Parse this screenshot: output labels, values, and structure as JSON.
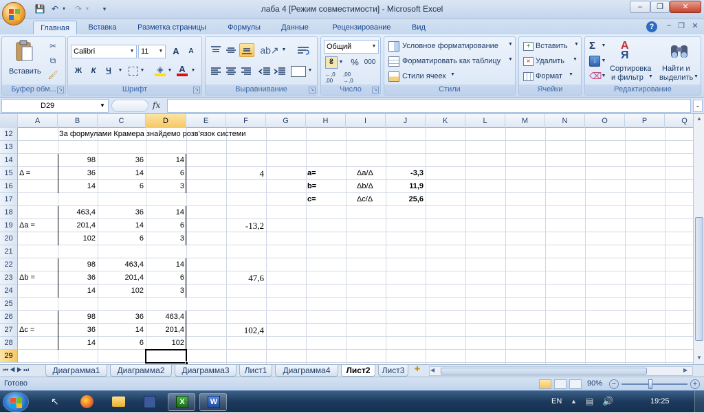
{
  "window": {
    "title": "лаба 4  [Режим совместимости] - Microsoft Excel",
    "qat_save": "💾",
    "qat_undo": "↶",
    "qat_redo": "↷",
    "minimize": "–",
    "restore": "❐",
    "close": "✕",
    "doc_minimize": "–",
    "doc_restore": "❐",
    "doc_close": "✕"
  },
  "ribbon": {
    "tabs": [
      "Главная",
      "Вставка",
      "Разметка страницы",
      "Формулы",
      "Данные",
      "Рецензирование",
      "Вид"
    ],
    "active_tab": "Главная",
    "help_icon": "?",
    "clipboard": {
      "label": "Буфер обм...",
      "paste": "Вставить"
    },
    "font": {
      "label": "Шрифт",
      "name": "Calibri",
      "size": "11",
      "grow": "A",
      "shrink": "A",
      "bold": "Ж",
      "italic": "К",
      "underline": "Ч",
      "color_letter": "A"
    },
    "alignment": {
      "label": "Выравнивание"
    },
    "number": {
      "label": "Число",
      "format": "Общий",
      "percent": "%",
      "thousands": "000",
      "inc_dec": "←,0 ,00",
      "dec_dec": ",00 →,0"
    },
    "styles": {
      "label": "Стили",
      "conditional": "Условное форматирование",
      "as_table": "Форматировать как таблицу",
      "cell_styles": "Стили ячеек"
    },
    "cells": {
      "label": "Ячейки",
      "insert": "Вставить",
      "delete": "Удалить",
      "format": "Формат"
    },
    "editing": {
      "label": "Редактирование",
      "sum": "Σ",
      "sort_l1": "Сортировка",
      "sort_l2": "и фильтр",
      "find_l1": "Найти и",
      "find_l2": "выделить"
    }
  },
  "formula_bar": {
    "name_box": "D29",
    "fx": "fx",
    "content": ""
  },
  "columns": [
    "A",
    "B",
    "C",
    "D",
    "E",
    "F",
    "G",
    "H",
    "I",
    "J",
    "K",
    "L",
    "M",
    "N",
    "O",
    "P",
    "Q"
  ],
  "selected_column": "D",
  "rows": [
    "12",
    "13",
    "14",
    "15",
    "16",
    "17",
    "18",
    "19",
    "20",
    "21",
    "22",
    "23",
    "24",
    "25",
    "26",
    "27",
    "28",
    "29"
  ],
  "selected_row": "29",
  "cells": {
    "r12_b": "За формулами Крамера знайдемо розв'язок системи",
    "r14": [
      "98",
      "36",
      "14"
    ],
    "r15_a": "Δ =",
    "r15": [
      "36",
      "14",
      "6"
    ],
    "r15_f": "4",
    "r16": [
      "14",
      "6",
      "3"
    ],
    "r18": [
      "463,4",
      "36",
      "14"
    ],
    "r19_a": "Δa =",
    "r19": [
      "201,4",
      "14",
      "6"
    ],
    "r19_f": "-13,2",
    "r20": [
      "102",
      "6",
      "3"
    ],
    "r22": [
      "98",
      "463,4",
      "14"
    ],
    "r23_a": "Δb =",
    "r23": [
      "36",
      "201,4",
      "6"
    ],
    "r23_f": "47,6",
    "r24": [
      "14",
      "102",
      "3"
    ],
    "r26": [
      "98",
      "36",
      "463,4"
    ],
    "r27_a": "Δc =",
    "r27": [
      "36",
      "14",
      "201,4"
    ],
    "r27_f": "102,4",
    "r28": [
      "14",
      "6",
      "102"
    ],
    "results": [
      {
        "name": "a=",
        "formula": "Δa/Δ",
        "value": "-3,3"
      },
      {
        "name": "b=",
        "formula": "Δb/Δ",
        "value": "11,9"
      },
      {
        "name": "c=",
        "formula": "Δc/Δ",
        "value": "25,6"
      }
    ]
  },
  "sheets": [
    "Диаграмма1",
    "Диаграмма2",
    "Диаграмма3",
    "Лист1",
    "Диаграмма4",
    "Лист2",
    "Лист3"
  ],
  "active_sheet": "Лист2",
  "status": {
    "ready": "Готово",
    "zoom": "90%"
  },
  "taskbar": {
    "language": "EN",
    "time": "19:25"
  }
}
